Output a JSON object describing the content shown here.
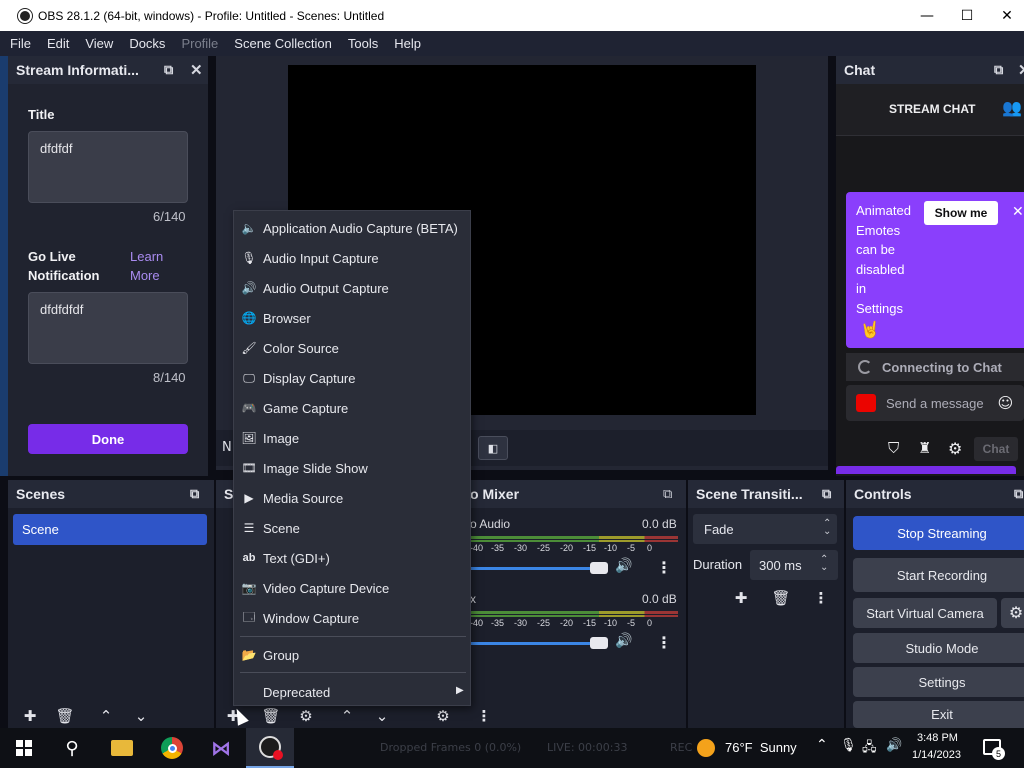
{
  "window": {
    "title": "OBS 28.1.2 (64-bit, windows) - Profile: Untitled - Scenes: Untitled",
    "minimize": "—",
    "maximize": "☐",
    "close": "✕"
  },
  "menu": [
    "File",
    "Edit",
    "View",
    "Docks",
    "Profile",
    "Scene Collection",
    "Tools",
    "Help"
  ],
  "stream_info": {
    "header": "Stream Informati...",
    "title_label": "Title",
    "title_value": "dfdfdf",
    "title_count": "6/140",
    "golive_label_1": "Go Live",
    "golive_label_2": "Notification",
    "learn_more_1": "Learn",
    "learn_more_2": "More",
    "notification_value": "dfdfdfdf",
    "notification_count": "8/140",
    "done": "Done"
  },
  "chat": {
    "header": "Chat",
    "stream_chat": "STREAM CHAT",
    "promo_text": [
      "Animated",
      "Emotes",
      "can be",
      "disabled",
      "in",
      "Settings"
    ],
    "show_me": "Show me",
    "connecting": "Connecting to Chat",
    "send_placeholder": "Send a message",
    "chat_button": "Chat"
  },
  "context_menu": {
    "items": [
      {
        "label": "Application Audio Capture (BETA)",
        "icon": "speaker-icon"
      },
      {
        "label": "Audio Input Capture",
        "icon": "microphone-icon"
      },
      {
        "label": "Audio Output Capture",
        "icon": "volume-icon"
      },
      {
        "label": "Browser",
        "icon": "globe-icon"
      },
      {
        "label": "Color Source",
        "icon": "brush-icon"
      },
      {
        "label": "Display Capture",
        "icon": "monitor-icon"
      },
      {
        "label": "Game Capture",
        "icon": "gamepad-icon"
      },
      {
        "label": "Image",
        "icon": "image-icon"
      },
      {
        "label": "Image Slide Show",
        "icon": "slideshow-icon"
      },
      {
        "label": "Media Source",
        "icon": "play-icon"
      },
      {
        "label": "Scene",
        "icon": "list-icon"
      },
      {
        "label": "Text (GDI+)",
        "icon": "text-icon"
      },
      {
        "label": "Video Capture Device",
        "icon": "camera-icon"
      },
      {
        "label": "Window Capture",
        "icon": "window-icon"
      }
    ],
    "group": "Group",
    "deprecated": "Deprecated"
  },
  "scenes": {
    "header": "Scenes",
    "items": [
      "Scene"
    ]
  },
  "sources": {
    "header_fragment": "S",
    "partial_label": "N"
  },
  "mixer": {
    "header_fragment": "o Mixer",
    "tracks": [
      {
        "name_fragment": "o Audio",
        "db": "0.0 dB",
        "volume": 0.9
      },
      {
        "name_fragment": "x",
        "db": "0.0 dB",
        "volume": 0.9
      }
    ],
    "scale": [
      "-40",
      "-35",
      "-30",
      "-25",
      "-20",
      "-15",
      "-10",
      "-5",
      "0"
    ]
  },
  "transitions": {
    "header": "Scene Transiti...",
    "transition": "Fade",
    "duration_label": "Duration",
    "duration_value": "300 ms"
  },
  "controls": {
    "header": "Controls",
    "stop_streaming": "Stop Streaming",
    "start_recording": "Start Recording",
    "start_virtual_camera": "Start Virtual Camera",
    "studio_mode": "Studio Mode",
    "settings": "Settings",
    "exit": "Exit"
  },
  "status": {
    "dropped": "Dropped Frames 0 (0.0%)",
    "live": "LIVE: 00:00:33",
    "rec": "REC"
  },
  "taskbar": {
    "weather": "76°F  Sunny",
    "time": "3:48 PM",
    "date": "1/14/2023",
    "notifications": "5"
  },
  "colors": {
    "accent_purple": "#772ce8",
    "selection_blue": "#2f55c8",
    "chat_promo": "#8a3ffc"
  }
}
